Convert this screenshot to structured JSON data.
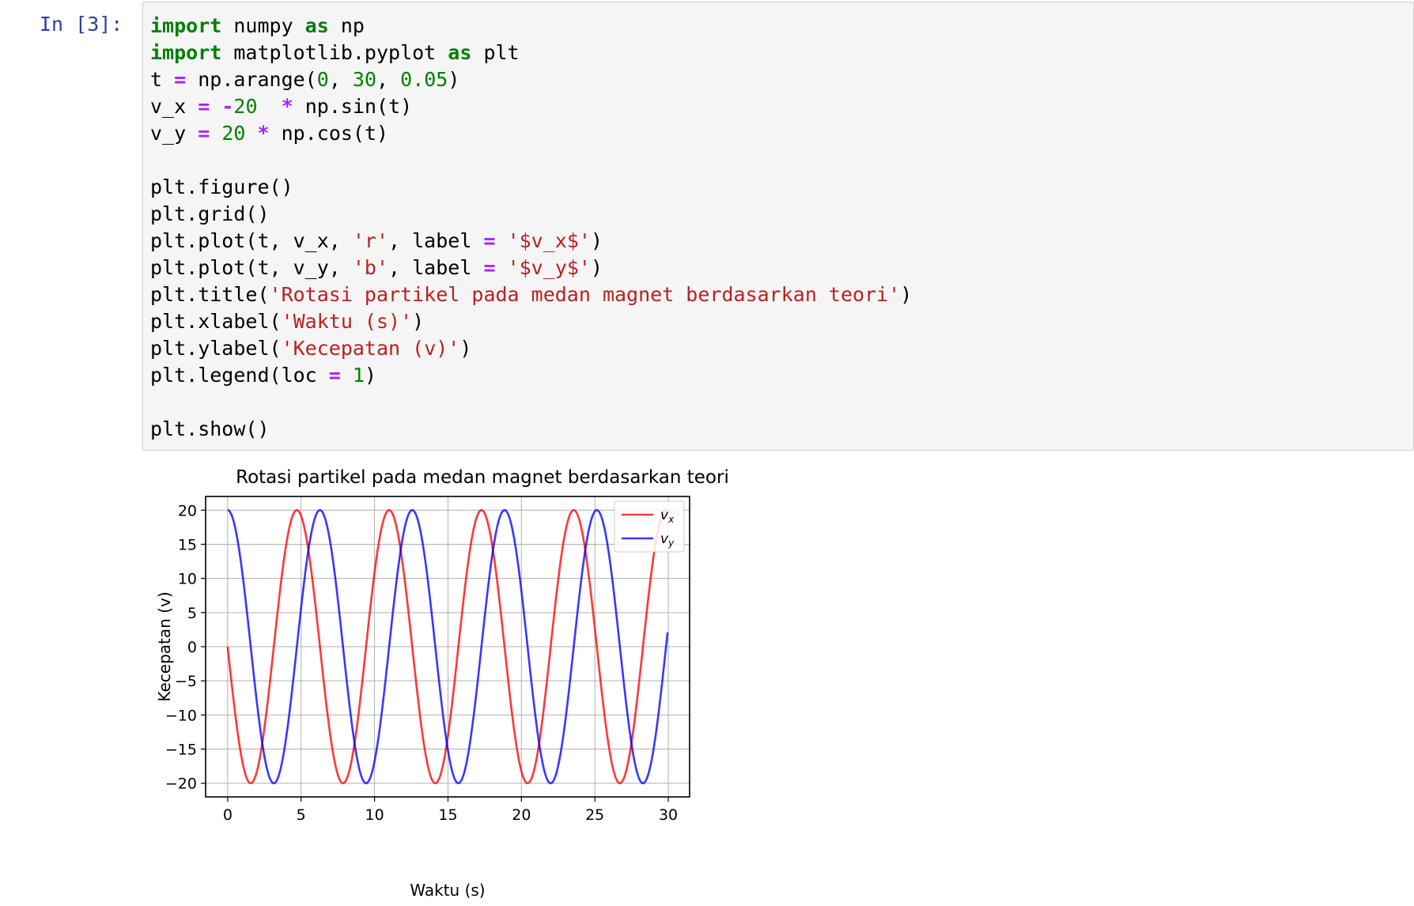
{
  "notebook": {
    "prompt": "In [3]:",
    "code_lines": [
      [
        {
          "t": "kw",
          "v": "import"
        },
        {
          "t": "p",
          "v": " numpy "
        },
        {
          "t": "kw",
          "v": "as"
        },
        {
          "t": "p",
          "v": " np"
        }
      ],
      [
        {
          "t": "kw",
          "v": "import"
        },
        {
          "t": "p",
          "v": " matplotlib.pyplot "
        },
        {
          "t": "kw",
          "v": "as"
        },
        {
          "t": "p",
          "v": " plt"
        }
      ],
      [
        {
          "t": "p",
          "v": "t "
        },
        {
          "t": "op",
          "v": "="
        },
        {
          "t": "p",
          "v": " np.arange("
        },
        {
          "t": "num",
          "v": "0"
        },
        {
          "t": "p",
          "v": ", "
        },
        {
          "t": "num",
          "v": "30"
        },
        {
          "t": "p",
          "v": ", "
        },
        {
          "t": "num",
          "v": "0.05"
        },
        {
          "t": "p",
          "v": ")"
        }
      ],
      [
        {
          "t": "p",
          "v": "v_x "
        },
        {
          "t": "op",
          "v": "="
        },
        {
          "t": "p",
          "v": " "
        },
        {
          "t": "op",
          "v": "-"
        },
        {
          "t": "num",
          "v": "20"
        },
        {
          "t": "p",
          "v": "  "
        },
        {
          "t": "op",
          "v": "*"
        },
        {
          "t": "p",
          "v": " np.sin(t)"
        }
      ],
      [
        {
          "t": "p",
          "v": "v_y "
        },
        {
          "t": "op",
          "v": "="
        },
        {
          "t": "p",
          "v": " "
        },
        {
          "t": "num",
          "v": "20"
        },
        {
          "t": "p",
          "v": " "
        },
        {
          "t": "op",
          "v": "*"
        },
        {
          "t": "p",
          "v": " np.cos(t)"
        }
      ],
      [],
      [
        {
          "t": "p",
          "v": "plt.figure()"
        }
      ],
      [
        {
          "t": "p",
          "v": "plt.grid()"
        }
      ],
      [
        {
          "t": "p",
          "v": "plt.plot(t, v_x, "
        },
        {
          "t": "str",
          "v": "'r'"
        },
        {
          "t": "p",
          "v": ", label "
        },
        {
          "t": "op",
          "v": "="
        },
        {
          "t": "p",
          "v": " "
        },
        {
          "t": "str",
          "v": "'$v_x$'"
        },
        {
          "t": "p",
          "v": ")"
        }
      ],
      [
        {
          "t": "p",
          "v": "plt.plot(t, v_y, "
        },
        {
          "t": "str",
          "v": "'b'"
        },
        {
          "t": "p",
          "v": ", label "
        },
        {
          "t": "op",
          "v": "="
        },
        {
          "t": "p",
          "v": " "
        },
        {
          "t": "str",
          "v": "'$v_y$'"
        },
        {
          "t": "p",
          "v": ")"
        }
      ],
      [
        {
          "t": "p",
          "v": "plt.title("
        },
        {
          "t": "str",
          "v": "'Rotasi partikel pada medan magnet berdasarkan teori'"
        },
        {
          "t": "p",
          "v": ")"
        }
      ],
      [
        {
          "t": "p",
          "v": "plt.xlabel("
        },
        {
          "t": "str",
          "v": "'Waktu (s)'"
        },
        {
          "t": "p",
          "v": ")"
        }
      ],
      [
        {
          "t": "p",
          "v": "plt.ylabel("
        },
        {
          "t": "str",
          "v": "'Kecepatan (v)'"
        },
        {
          "t": "p",
          "v": ")"
        }
      ],
      [
        {
          "t": "p",
          "v": "plt.legend(loc "
        },
        {
          "t": "op",
          "v": "="
        },
        {
          "t": "p",
          "v": " "
        },
        {
          "t": "num",
          "v": "1"
        },
        {
          "t": "p",
          "v": ")"
        }
      ],
      [],
      [
        {
          "t": "p",
          "v": "plt.show()"
        }
      ]
    ]
  },
  "chart_data": {
    "type": "line",
    "title": "Rotasi partikel pada medan magnet berdasarkan teori",
    "xlabel": "Waktu (s)",
    "ylabel": "Kecepatan (v)",
    "xlim": [
      -1.5,
      31.45
    ],
    "ylim": [
      -22,
      22
    ],
    "xticks": [
      0,
      5,
      10,
      15,
      20,
      25,
      30
    ],
    "xtick_labels": [
      "0",
      "5",
      "10",
      "15",
      "20",
      "25",
      "30"
    ],
    "yticks": [
      20,
      15,
      10,
      5,
      0,
      -5,
      -10,
      -15,
      -20
    ],
    "ytick_labels": [
      "20",
      "15",
      "10",
      "5",
      "0",
      "−5",
      "−10",
      "−15",
      "−20"
    ],
    "grid": true,
    "legend_position": "top-right",
    "x": {
      "start": 0,
      "stop": 30,
      "step": 0.05
    },
    "series": [
      {
        "name": "v_x",
        "legend_main": "v",
        "legend_sub": "x",
        "expression": "-20 * sin(t)",
        "amplitude": -20,
        "func": "sin",
        "color": "#ff0000"
      },
      {
        "name": "v_y",
        "legend_main": "v",
        "legend_sub": "y",
        "expression": "20 * cos(t)",
        "amplitude": 20,
        "func": "cos",
        "color": "#0000ff"
      }
    ]
  }
}
